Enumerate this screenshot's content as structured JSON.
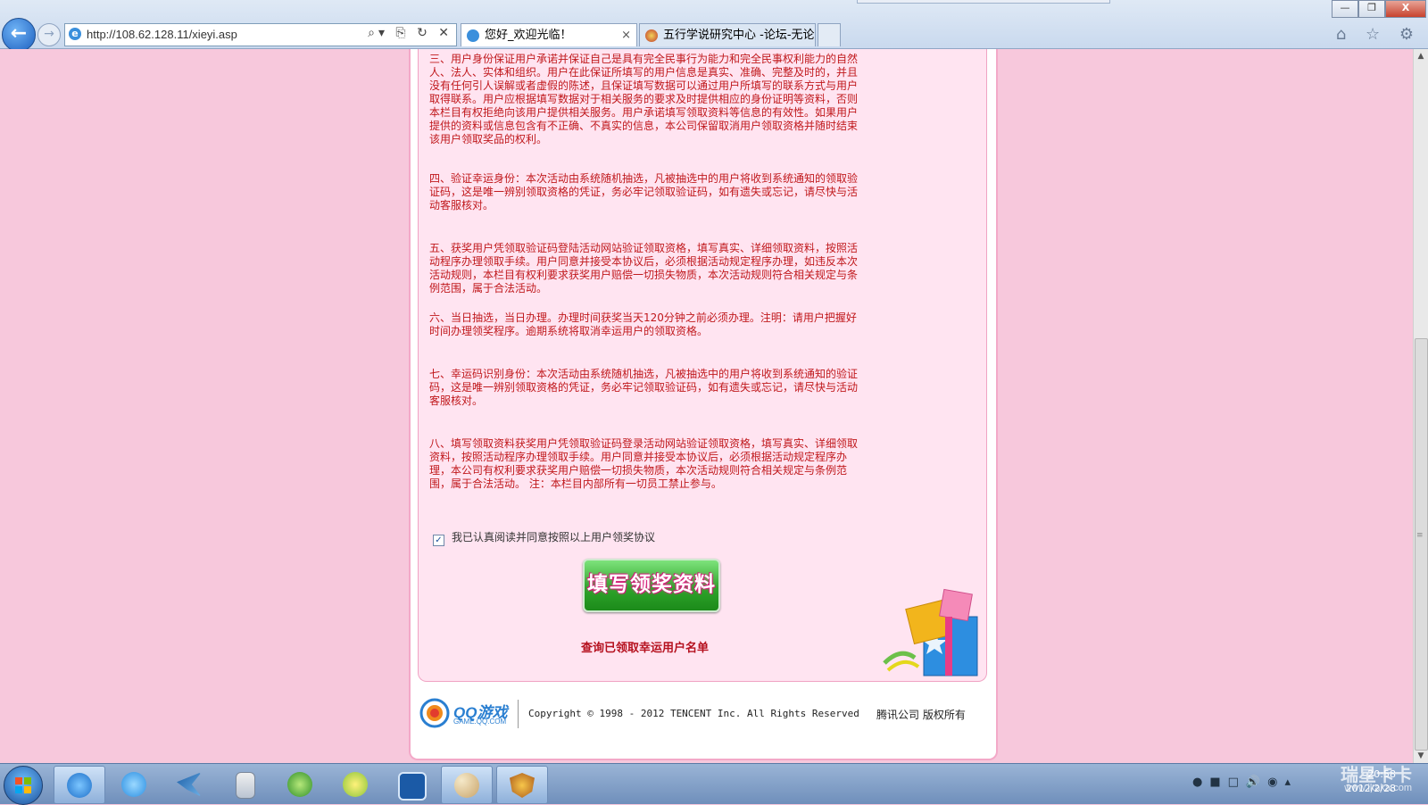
{
  "browser": {
    "url": "http://108.62.128.11/xieyi.asp",
    "tabs": [
      {
        "label": "您好_欢迎光临！",
        "active": true
      },
      {
        "label": "五行学说研究中心 -论坛-无论...",
        "active": false
      }
    ],
    "tab_close": "×",
    "window_buttons": {
      "minimize": "—",
      "restore": "❐",
      "close": "X"
    },
    "addr_controls": "⌕▾ ⎘ ↻ ✕",
    "toolbar_icons": "⌂ ☆ ⚙"
  },
  "terms": {
    "paragraphs": [
      "三、用户身份保证用户承诺并保证自己是具有完全民事行为能力和完全民事权利能力的自然人、法人、实体和组织。用户在此保证所填写的用户信息是真实、准确、完整及时的，并且没有任何引人误解或者虚假的陈述，且保证填写数据可以通过用户所填写的联系方式与用户取得联系。用户应根据填写数据对于相关服务的要求及时提供相应的身份证明等资料，否则本栏目有权拒绝向该用户提供相关服务。用户承诺填写领取资料等信息的有效性。如果用户提供的资料或信息包含有不正确、不真实的信息，本公司保留取消用户领取资格并随时结束该用户领取奖品的权利。",
      "四、验证幸运身份：本次活动由系统随机抽选，凡被抽选中的用户将收到系统通知的领取验证码，这是唯一辨别领取资格的凭证，务必牢记领取验证码，如有遗失或忘记，请尽快与活动客服核对。",
      "五、获奖用户凭领取验证码登陆活动网站验证领取资格，填写真实、详细领取资料，按照活动程序办理领取手续。用户同意并接受本协议后，必须根据活动规定程序办理，如违反本次活动规则，本栏目有权利要求获奖用户赔偿一切损失物质，本次活动规则符合相关规定与条例范围，属于合法活动。",
      "六、当日抽选，当日办理。办理时间获奖当天120分钟之前必须办理。注明：请用户把握好时间办理领奖程序。逾期系统将取消幸运用户的领取资格。",
      "七、幸运码识别身份：本次活动由系统随机抽选，凡被抽选中的用户将收到系统通知的验证码，这是唯一辨别领取资格的凭证，务必牢记领取验证码，如有遗失或忘记，请尽快与活动客服核对。",
      "八、填写领取资料获奖用户凭领取验证码登录活动网站验证领取资格，填写真实、详细领取资料，按照活动程序办理领取手续。用户同意并接受本协议后，必须根据活动规定程序办理，本公司有权利要求获奖用户赔偿一切损失物质，本次活动规则符合相关规定与条例范围，属于合法活动。 注：本栏目内部所有一切员工禁止参与。"
    ]
  },
  "agree": {
    "label": "我已认真阅读并同意按照以上用户领奖协议",
    "checked": true,
    "check_glyph": "✓"
  },
  "buttons": {
    "fill_form": "填写领奖资料"
  },
  "links": {
    "query": "查询已领取幸运用户名单"
  },
  "footer": {
    "logo_text": "QQ游戏",
    "logo_sub": "GAME.QQ.COM",
    "copyright": "Copyright © 1998 - 2012 TENCENT Inc. All Rights Reserved",
    "company": "腾讯公司 版权所有"
  },
  "taskbar": {
    "apps": [
      "ie-icon",
      "qq-icon",
      "bird-icon",
      "calculator-icon",
      "globe-icon",
      "fruit-icon",
      "player-icon",
      "paint-icon",
      "shield-game-icon"
    ],
    "active_app": "ie-icon",
    "date": "2012/2/28",
    "time": "20:58"
  },
  "watermark": {
    "text": "瑞星卡卡",
    "site": "www.ikaka.com"
  },
  "colors": {
    "page_bg": "#f7c8dc",
    "terms_text": "#c0181c",
    "panel_bg": "#ffe4f1",
    "button_green": "#2ea62b"
  }
}
